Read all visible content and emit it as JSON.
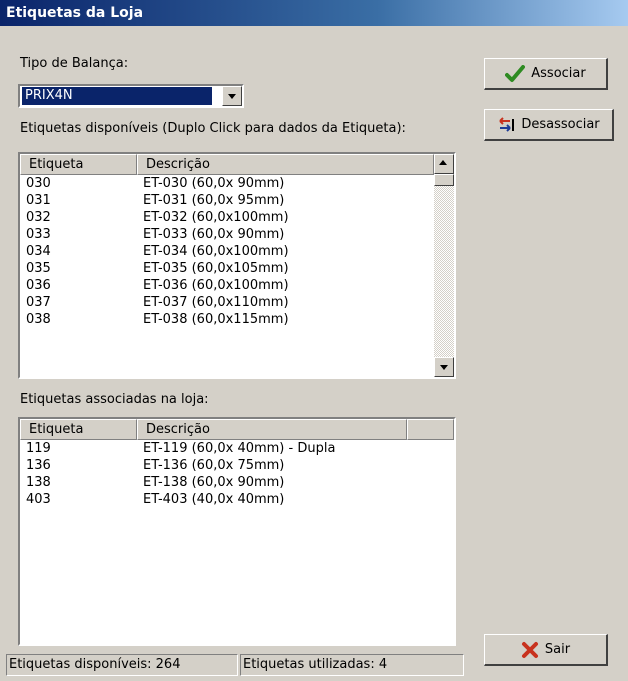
{
  "window": {
    "title": "Etiquetas da Loja"
  },
  "scale_type": {
    "label": "Tipo de Balança:",
    "value": "PRIX4N"
  },
  "available": {
    "label": "Etiquetas disponíveis (Duplo Click para dados da Etiqueta):",
    "columns": [
      "Etiqueta",
      "Descrição"
    ],
    "rows": [
      {
        "code": "030",
        "desc": "ET-030 (60,0x  90mm)"
      },
      {
        "code": "031",
        "desc": "ET-031 (60,0x  95mm)"
      },
      {
        "code": "032",
        "desc": "ET-032 (60,0x100mm)"
      },
      {
        "code": "033",
        "desc": "ET-033 (60,0x  90mm)"
      },
      {
        "code": "034",
        "desc": "ET-034 (60,0x100mm)"
      },
      {
        "code": "035",
        "desc": "ET-035 (60,0x105mm)"
      },
      {
        "code": "036",
        "desc": "ET-036 (60,0x100mm)"
      },
      {
        "code": "037",
        "desc": "ET-037 (60,0x110mm)"
      },
      {
        "code": "038",
        "desc": "ET-038 (60,0x115mm)"
      }
    ]
  },
  "associated": {
    "label": "Etiquetas associadas na loja:",
    "columns": [
      "Etiqueta",
      "Descrição",
      ""
    ],
    "rows": [
      {
        "code": "119",
        "desc": "ET-119 (60,0x  40mm) - Dupla"
      },
      {
        "code": "136",
        "desc": "ET-136 (60,0x  75mm)"
      },
      {
        "code": "138",
        "desc": "ET-138 (60,0x  90mm)"
      },
      {
        "code": "403",
        "desc": "ET-403 (40,0x  40mm)"
      }
    ]
  },
  "buttons": {
    "associate": "Associar",
    "disassociate": "Desassociar",
    "exit": "Sair"
  },
  "status": {
    "available": "Etiquetas disponíveis: 264",
    "used": "Etiquetas utilizadas: 4"
  },
  "colors": {
    "title_bar": "#0a246a",
    "selection": "#0a246a",
    "check_icon": "#2e8b22",
    "x_icon": "#c8321e",
    "face": "#d4d0c8"
  },
  "icons": {
    "associate": "check-icon",
    "disassociate": "swap-arrows-icon",
    "exit": "x-icon"
  }
}
